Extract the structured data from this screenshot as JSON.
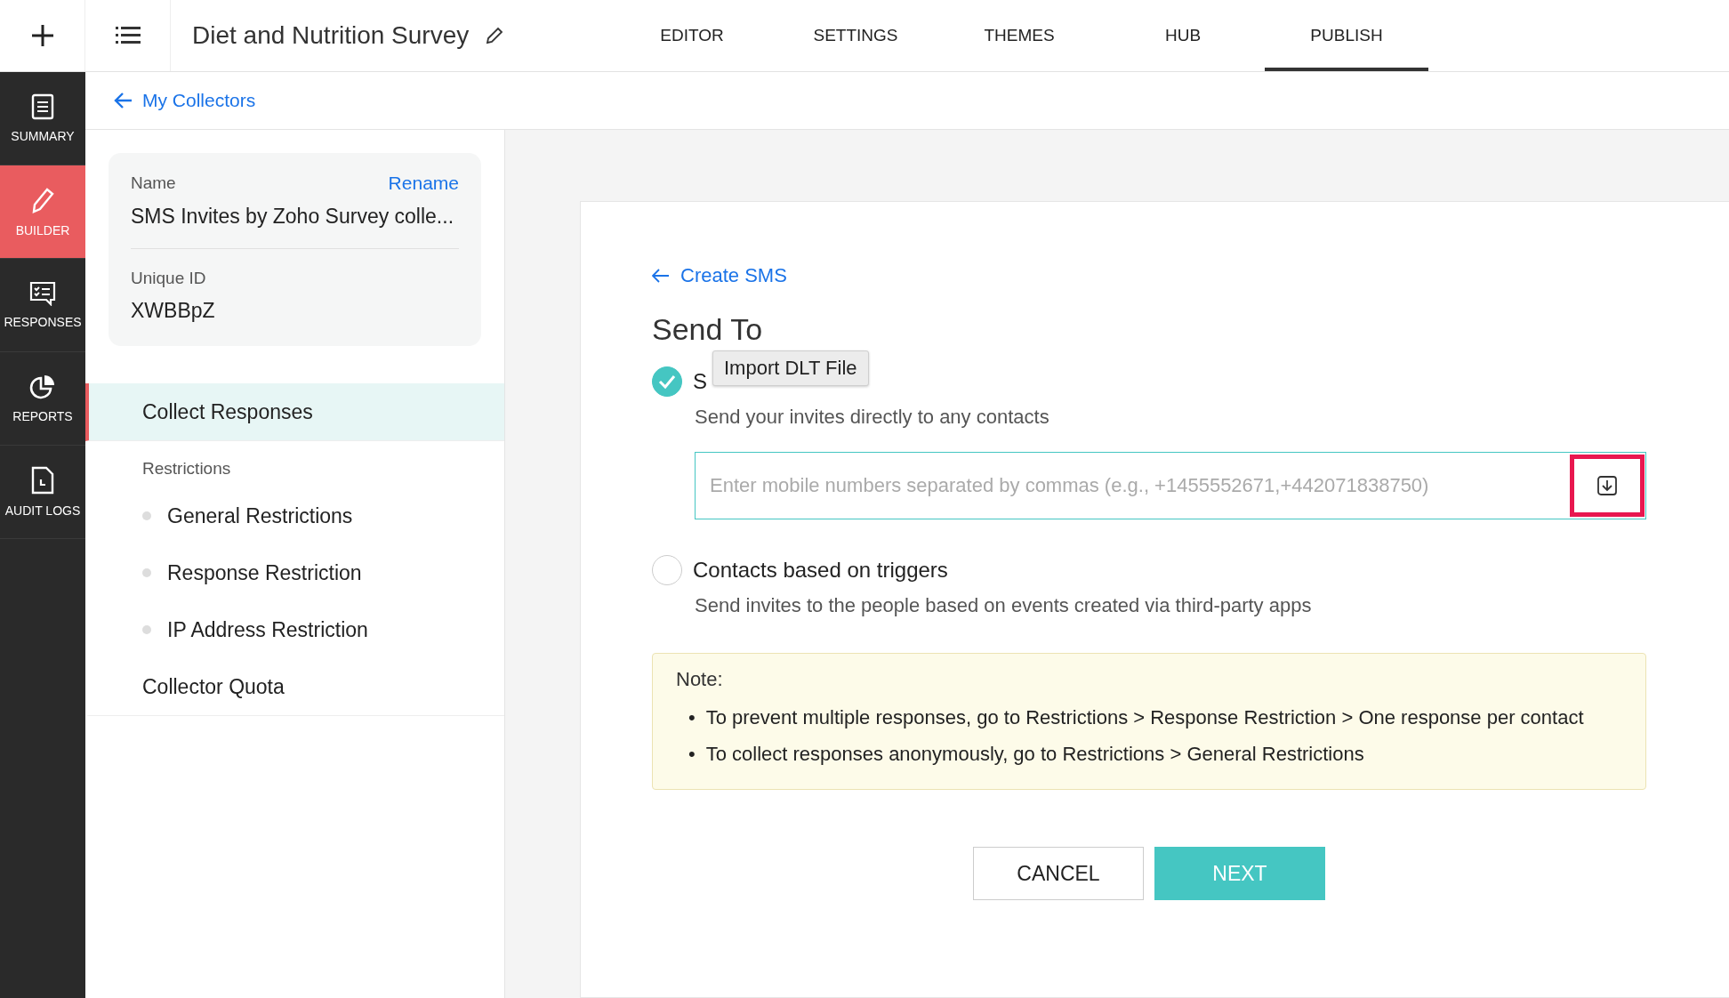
{
  "topbar": {
    "title": "Diet and Nutrition Survey",
    "tabs": [
      {
        "label": "EDITOR",
        "selected": false
      },
      {
        "label": "SETTINGS",
        "selected": false
      },
      {
        "label": "THEMES",
        "selected": false
      },
      {
        "label": "HUB",
        "selected": false
      },
      {
        "label": "PUBLISH",
        "selected": true
      }
    ]
  },
  "rail": [
    {
      "label": "SUMMARY",
      "selected": false
    },
    {
      "label": "BUILDER",
      "selected": true
    },
    {
      "label": "RESPONSES",
      "selected": false
    },
    {
      "label": "REPORTS",
      "selected": false
    },
    {
      "label": "AUDIT LOGS",
      "selected": false
    }
  ],
  "back_link": "My Collectors",
  "collector": {
    "name_label": "Name",
    "rename": "Rename",
    "name": "SMS Invites by Zoho Survey colle...",
    "id_label": "Unique ID",
    "id": "XWBBpZ"
  },
  "menu": [
    {
      "kind": "item",
      "label": "Collect Responses",
      "selected": true
    },
    {
      "kind": "heading",
      "label": "Restrictions"
    },
    {
      "kind": "sub",
      "label": "General Restrictions",
      "selected": false
    },
    {
      "kind": "sub",
      "label": "Response Restriction",
      "selected": false
    },
    {
      "kind": "sub",
      "label": "IP Address Restriction",
      "selected": false
    },
    {
      "kind": "item",
      "label": "Collector Quota",
      "selected": false
    }
  ],
  "form": {
    "back": "Create SMS",
    "heading": "Send To",
    "options": [
      {
        "label": "S",
        "description": "Send your invites directly to any contacts",
        "selected": true,
        "placeholder": "Enter mobile numbers separated by commas (e.g., +1455552671,+442071838750)",
        "tooltip": "Import DLT File"
      },
      {
        "label": "Contacts based on triggers",
        "description": "Send invites to the people based on events created via third-party apps",
        "selected": false
      }
    ],
    "note": {
      "title": "Note:",
      "items": [
        {
          "bullet": "•",
          "text": "To prevent multiple responses, go to Restrictions > Response Restriction > One response per contact"
        },
        {
          "bullet": "•",
          "text": "To collect responses anonymously, go to Restrictions > General Restrictions"
        }
      ]
    },
    "buttons": [
      {
        "label": "CANCEL",
        "kind": "secondary"
      },
      {
        "label": "NEXT",
        "kind": "primary"
      }
    ]
  }
}
